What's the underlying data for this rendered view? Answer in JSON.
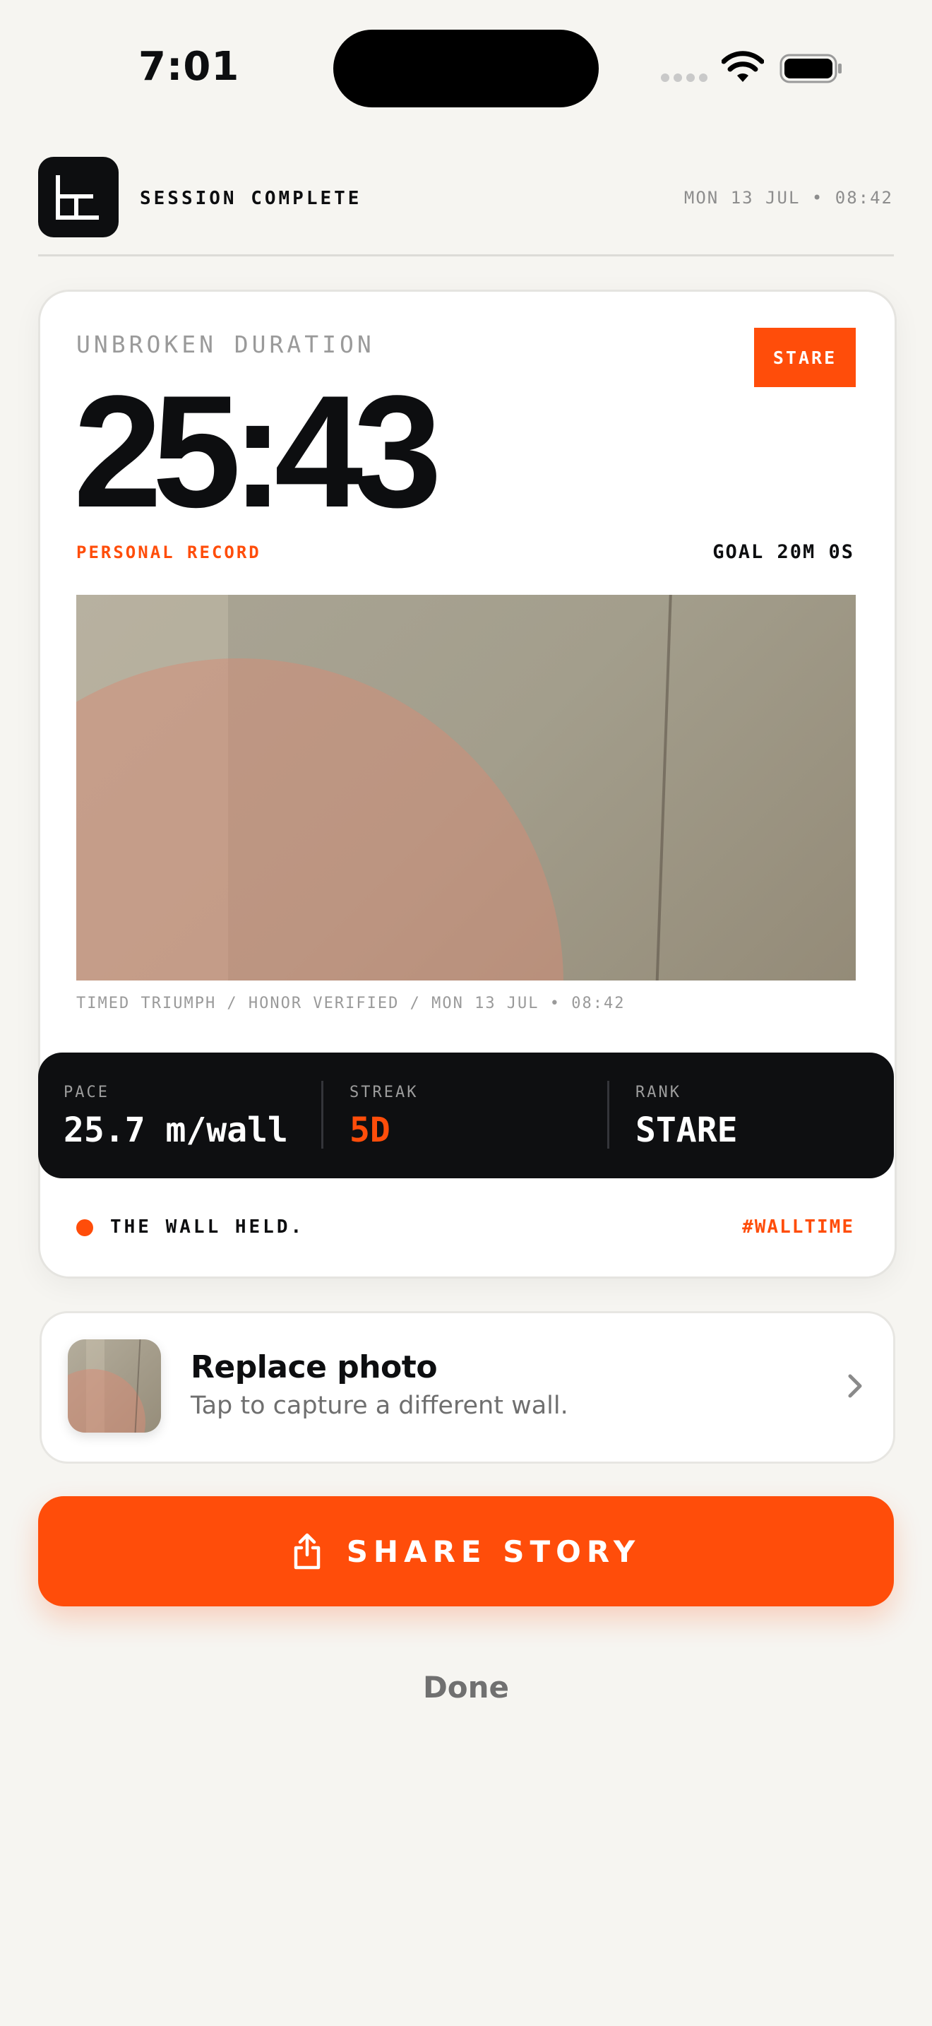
{
  "status_bar": {
    "time": "7:01"
  },
  "header": {
    "title": "SESSION COMPLETE",
    "date": "MON 13 JUL • 08:42"
  },
  "card": {
    "duration_label": "UNBROKEN DURATION",
    "badge": "STARE",
    "duration": "25:43",
    "record_label": "PERSONAL RECORD",
    "goal_label": "GOAL 20M 0S",
    "caption": "TIMED TRIUMPH / HONOR VERIFIED / MON 13 JUL • 08:42",
    "stats": [
      {
        "label": "PACE",
        "value": "25.7 m/wall"
      },
      {
        "label": "STREAK",
        "value": "5D"
      },
      {
        "label": "RANK",
        "value": "STARE"
      }
    ],
    "footer_text": "THE WALL HELD.",
    "hashtag": "#WALLTIME"
  },
  "replace_photo": {
    "title": "Replace photo",
    "subtitle": "Tap to capture a different wall."
  },
  "share_button": {
    "label": "SHARE STORY"
  },
  "done_button": {
    "label": "Done"
  },
  "colors": {
    "accent": "#ff4d0a",
    "dark": "#0e0f11",
    "background": "#f6f5f1"
  }
}
